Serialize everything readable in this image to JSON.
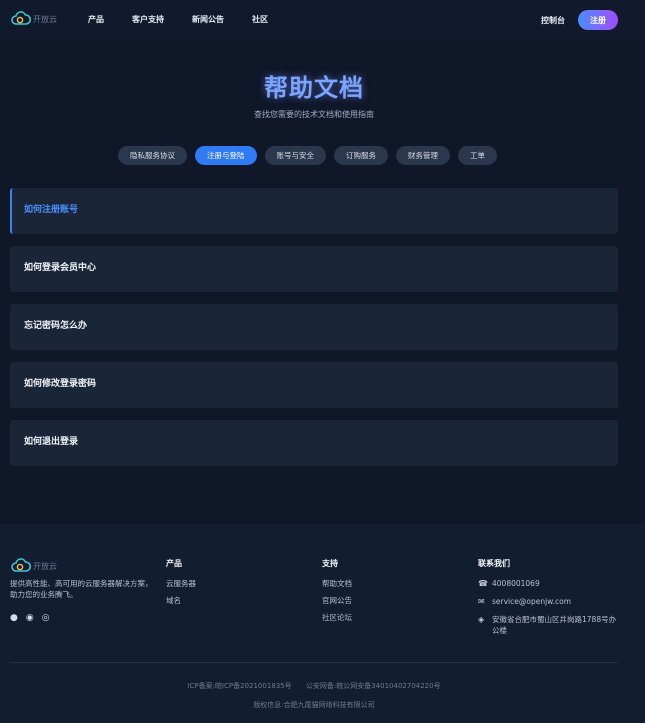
{
  "brand": {
    "name": "开放云"
  },
  "nav": {
    "items": [
      "产品",
      "客户支持",
      "新闻公告",
      "社区"
    ],
    "console": "控制台",
    "register": "注册"
  },
  "hero": {
    "title": "帮助文档",
    "subtitle": "查找您需要的技术文档和使用指南"
  },
  "tabs": [
    {
      "label": "隐私服务协议",
      "active": false
    },
    {
      "label": "注册与登陆",
      "active": true
    },
    {
      "label": "账号与安全",
      "active": false
    },
    {
      "label": "订购服务",
      "active": false
    },
    {
      "label": "财务管理",
      "active": false
    },
    {
      "label": "工单",
      "active": false
    }
  ],
  "faq": [
    "如何注册账号",
    "如何登录会员中心",
    "忘记密码怎么办",
    "如何修改登录密码",
    "如何退出登录"
  ],
  "footer": {
    "desc": "提供高性能、高可用的云服务器解决方案，助力您的业务腾飞。",
    "products": {
      "title": "产品",
      "links": [
        "云服务器",
        "域名"
      ]
    },
    "support": {
      "title": "支持",
      "links": [
        "帮助文档",
        "官网公告",
        "社区论坛"
      ]
    },
    "contact": {
      "title": "联系我们",
      "phone": "4008001069",
      "email": "service@openjw.com",
      "address": "安徽省合肥市蜀山区井岗路1788号办公楼"
    },
    "icp": "ICP备案:皖ICP备2021001835号",
    "police": "公安网备:皖公网安备34010402704220号",
    "copyright": "版权信息:合肥九尾猫网络科技有限公司"
  },
  "colors": {
    "accent": "#2f7bf5",
    "background": "#0f1729",
    "card": "#1b2538"
  }
}
